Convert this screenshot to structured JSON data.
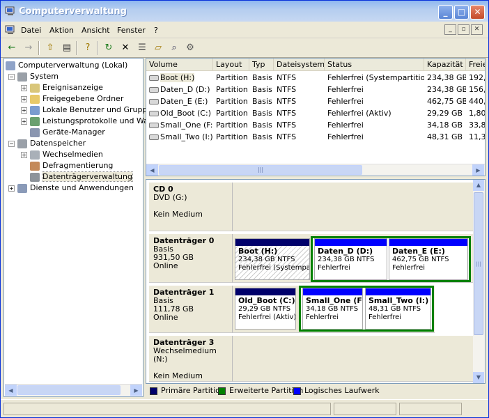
{
  "window": {
    "title": "Computerverwaltung",
    "min": "_",
    "max": "□",
    "close": "✕"
  },
  "menu": [
    "Datei",
    "Aktion",
    "Ansicht",
    "Fenster",
    "?"
  ],
  "mdi": {
    "min": "_",
    "restore": "▫",
    "close": "✕"
  },
  "toolbar": {
    "back": "←",
    "fwd": "→",
    "up": "⇧",
    "tree": "▤",
    "help": "?",
    "refresh": "↻",
    "delete": "✕",
    "props": "☰",
    "open": "▱",
    "search": "⌕",
    "settings": "⚙"
  },
  "tree": {
    "root": "Computerverwaltung (Lokal)",
    "system": "System",
    "eventlog": "Ereignisanzeige",
    "shares": "Freigegebene Ordner",
    "users": "Lokale Benutzer und Gruppen",
    "perf": "Leistungsprotokolle und Warnungen",
    "devmgr": "Geräte-Manager",
    "storage": "Datenspeicher",
    "removable": "Wechselmedien",
    "defrag": "Defragmentierung",
    "diskmgmt": "Datenträgerverwaltung",
    "services": "Dienste und Anwendungen",
    "expand_plus": "+",
    "expand_minus": "−"
  },
  "list": {
    "headers": [
      "Volume",
      "Layout",
      "Typ",
      "Dateisystem",
      "Status",
      "Kapazität",
      "Freier Speicher"
    ],
    "rows": [
      [
        "Boot (H:)",
        "Partition",
        "Basis",
        "NTFS",
        "Fehlerfrei (Systempartition)",
        "234,38 GB",
        "192,"
      ],
      [
        "Daten_D (D:)",
        "Partition",
        "Basis",
        "NTFS",
        "Fehlerfrei",
        "234,38 GB",
        "156,"
      ],
      [
        "Daten_E (E:)",
        "Partition",
        "Basis",
        "NTFS",
        "Fehlerfrei",
        "462,75 GB",
        "440,"
      ],
      [
        "Old_Boot (C:)",
        "Partition",
        "Basis",
        "NTFS",
        "Fehlerfrei (Aktiv)",
        "29,29 GB",
        "1,80"
      ],
      [
        "Small_One (F:)",
        "Partition",
        "Basis",
        "NTFS",
        "Fehlerfrei",
        "34,18 GB",
        "33,8"
      ],
      [
        "Small_Two (I:)",
        "Partition",
        "Basis",
        "NTFS",
        "Fehlerfrei",
        "48,31 GB",
        "11,3"
      ]
    ]
  },
  "disks": {
    "cd0": {
      "name": "CD 0",
      "l1": "DVD (G:)",
      "l2": "",
      "l3": "Kein Medium"
    },
    "d0": {
      "name": "Datenträger 0",
      "l1": "Basis",
      "l2": "931,50 GB",
      "l3": "Online",
      "p1": {
        "name": "Boot  (H:)",
        "size": "234,38 GB NTFS",
        "status": "Fehlerfrei (Systempartition)"
      },
      "p2": {
        "name": "Daten_D  (D:)",
        "size": "234,38 GB NTFS",
        "status": "Fehlerfrei"
      },
      "p3": {
        "name": "Daten_E  (E:)",
        "size": "462,75 GB NTFS",
        "status": "Fehlerfrei"
      }
    },
    "d1": {
      "name": "Datenträger 1",
      "l1": "Basis",
      "l2": "111,78 GB",
      "l3": "Online",
      "p1": {
        "name": "Old_Boot  (C:)",
        "size": "29,29 GB NTFS",
        "status": "Fehlerfrei (Aktiv)"
      },
      "p2": {
        "name": "Small_One  (F:)",
        "size": "34,18 GB NTFS",
        "status": "Fehlerfrei"
      },
      "p3": {
        "name": "Small_Two  (I:)",
        "size": "48,31 GB NTFS",
        "status": "Fehlerfrei"
      }
    },
    "d3": {
      "name": "Datenträger 3",
      "l1": "Wechselmedium (N:)",
      "l2": "",
      "l3": "Kein Medium"
    }
  },
  "legend": {
    "primary": "Primäre Partition",
    "extended": "Erweiterte Partition",
    "logical": "Logisches Laufwerk"
  },
  "colors": {
    "primary": "#00006b",
    "extended": "#008000",
    "logical": "#0000ff"
  },
  "scroll": {
    "left": "◀",
    "right": "▶",
    "up": "▲",
    "down": "▼",
    "grip": "|||"
  }
}
